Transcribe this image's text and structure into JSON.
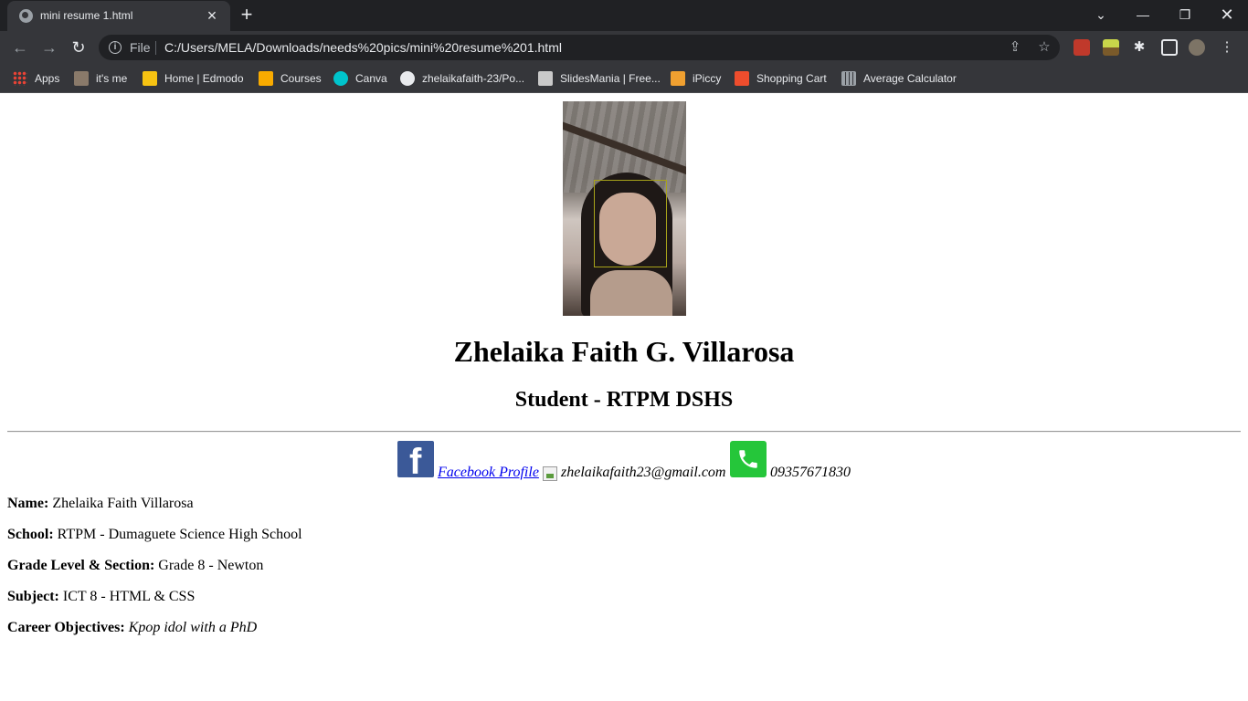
{
  "browser": {
    "tab_title": "mini resume 1.html",
    "scheme_label": "File",
    "url": "C:/Users/MELA/Downloads/needs%20pics/mini%20resume%201.html",
    "bookmarks": [
      {
        "label": "Apps",
        "icon": "apps-grid-icon",
        "color": "#ea4335"
      },
      {
        "label": "it's me",
        "icon": "photo-favicon",
        "color": "#8a7a6a"
      },
      {
        "label": "Home | Edmodo",
        "icon": "edmodo-favicon",
        "color": "#f7c312"
      },
      {
        "label": "Courses",
        "icon": "classroom-favicon",
        "color": "#f9ab00"
      },
      {
        "label": "Canva",
        "icon": "canva-favicon",
        "color": "#00c4cc"
      },
      {
        "label": "zhelaikafaith-23/Po...",
        "icon": "github-favicon",
        "color": "#e8eaed"
      },
      {
        "label": "SlidesMania | Free...",
        "icon": "slidesmania-favicon",
        "color": "#c9c9c9"
      },
      {
        "label": "iPiccy",
        "icon": "ipiccy-favicon",
        "color": "#f0a030"
      },
      {
        "label": "Shopping Cart",
        "icon": "shopee-favicon",
        "color": "#ee4d2d"
      },
      {
        "label": "Average Calculator",
        "icon": "calculator-favicon",
        "color": "#9aa0a6"
      }
    ]
  },
  "page": {
    "name_heading": "Zhelaika Faith G. Villarosa",
    "sub_heading": "Student - RTPM DSHS",
    "facebook_link": "Facebook Profile",
    "email": "zhelaikafaith23@gmail.com",
    "phone": "09357671830",
    "details": [
      {
        "label": "Name:",
        "value": "Zhelaika Faith Villarosa",
        "italic": false
      },
      {
        "label": "School:",
        "value": "RTPM - Dumaguete Science High School",
        "italic": false
      },
      {
        "label": "Grade Level & Section:",
        "value": "Grade 8 - Newton",
        "italic": false
      },
      {
        "label": "Subject:",
        "value": "ICT 8 - HTML & CSS",
        "italic": false
      },
      {
        "label": "Career Objectives:",
        "value": "Kpop idol with a PhD",
        "italic": true
      }
    ]
  }
}
